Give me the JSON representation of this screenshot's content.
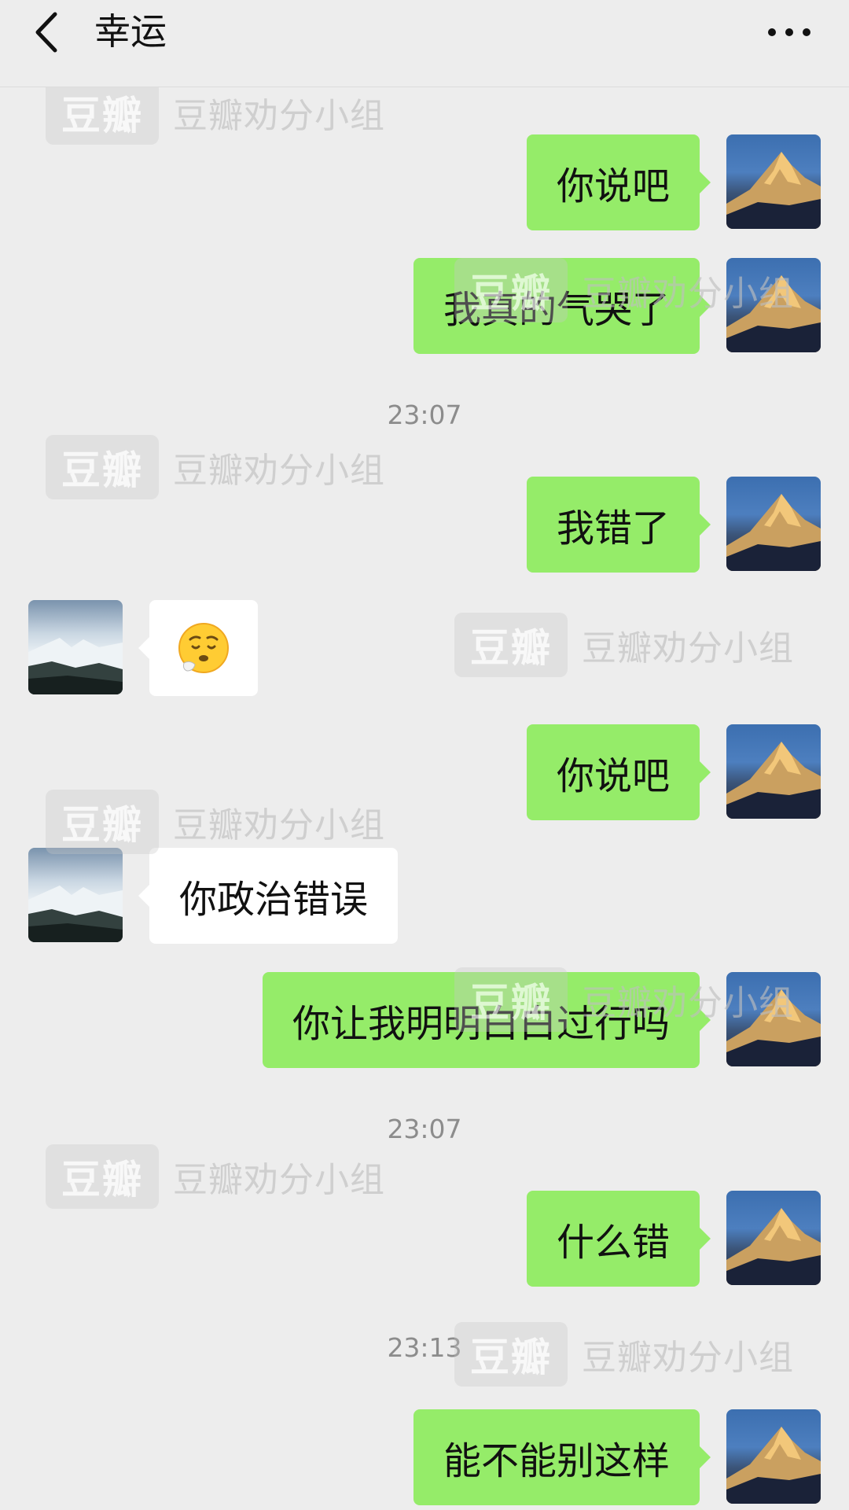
{
  "header": {
    "title": "幸运",
    "back_icon": "chevron-left-icon",
    "more_icon": "more-horizontal-icon"
  },
  "watermark": {
    "logo": "豆瓣",
    "text": "豆瓣劝分小组"
  },
  "colors": {
    "background": "#ededed",
    "sent_bubble": "#95ec69",
    "received_bubble": "#ffffff",
    "timestamp": "#8c8c8c"
  },
  "messages": [
    {
      "type": "sent",
      "text": "你说吧"
    },
    {
      "type": "sent",
      "text": "我真的气哭了"
    },
    {
      "type": "time",
      "text": "23:07"
    },
    {
      "type": "sent",
      "text": "我错了"
    },
    {
      "type": "received",
      "emoji": "sad-face-emoji"
    },
    {
      "type": "sent",
      "text": "你说吧"
    },
    {
      "type": "received",
      "text": "你政治错误"
    },
    {
      "type": "sent",
      "text": "你让我明明白白过行吗"
    },
    {
      "type": "time",
      "text": "23:07"
    },
    {
      "type": "sent",
      "text": "什么错"
    },
    {
      "type": "time",
      "text": "23:13"
    },
    {
      "type": "sent",
      "text": "能不能别这样"
    }
  ]
}
